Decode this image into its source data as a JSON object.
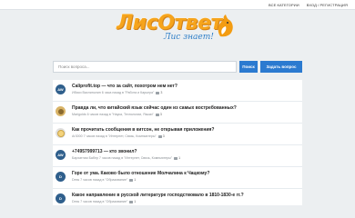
{
  "topbar": {
    "categories": "ВСЕ КАТЕГОРИИ",
    "auth": "ВХОД / РЕГИСТРАЦИЯ"
  },
  "logo": {
    "title": "ЛисОтвет",
    "slogan": "Лис знает!"
  },
  "search": {
    "placeholder": "Поиск вопроса...",
    "search_button": "Поиск",
    "ask_button": "Задать вопрос"
  },
  "questions": [
    {
      "avatar": "AW",
      "title": "Caliprofit.top — что за сайт, похотром нем нет?",
      "meta": "Ибиси Вахлиполин 6 часа назад в \"Работа и Карьера\"",
      "comments": "3"
    },
    {
      "avatar": "",
      "title": "Правда ли, что китайский язык сейчас один из самых востребованных?",
      "meta": "Marigolds 6 часов назад в \"Наука, Технологии, Языки\"",
      "comments": "3"
    },
    {
      "avatar": "",
      "title": "Как прочитать сообщения в китсон, не открывая приложения?",
      "meta": "Ar3000 7 часов назад в \"Интернет, Связь, Компьютеры\"",
      "comments": "3"
    },
    {
      "avatar": "AW",
      "title": "+74957999713 — кто звонил?",
      "meta": "Бархатная Бабер 7 часов назад в \"Интернет, Связь, Компьютеры\"",
      "comments": "1"
    },
    {
      "avatar": "D",
      "title": "Горе от ума. Каково было отношение Молчалина к Чацкому?",
      "meta": "Dess 7 часов назад в \"Образование\"",
      "comments": "1"
    },
    {
      "avatar": "D",
      "title": "Какое направление в русской литературе господствовало в 1810-1830-е гг.?",
      "meta": "Dess 7 часов назад в \"Образование\"",
      "comments": "1"
    }
  ],
  "colors": {
    "accent": "#2b7ad0",
    "logo_orange": "#f6a41c",
    "background": "#eceff1"
  }
}
